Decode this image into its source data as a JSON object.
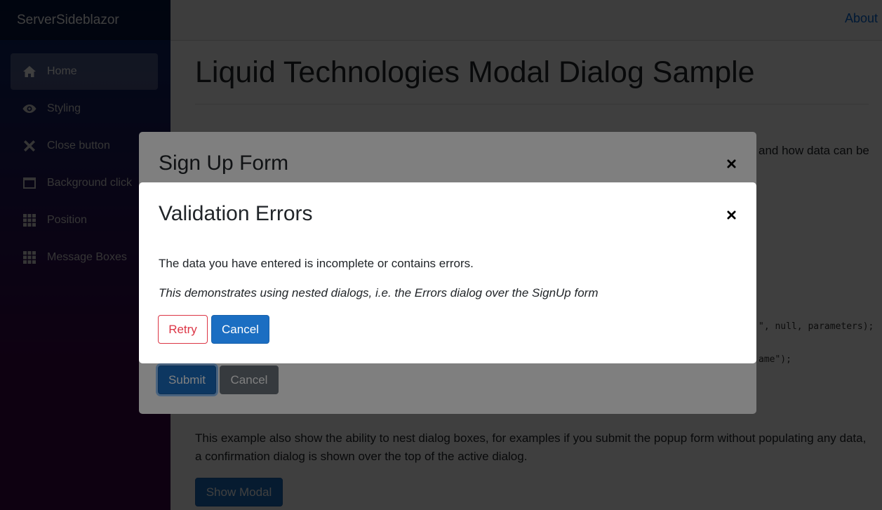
{
  "brand": "ServerSideblazor",
  "sidebar": {
    "items": [
      {
        "label": "Home",
        "icon": "home-icon"
      },
      {
        "label": "Styling",
        "icon": "eye-icon"
      },
      {
        "label": "Close button",
        "icon": "x-icon"
      },
      {
        "label": "Background click",
        "icon": "window-icon"
      },
      {
        "label": "Position",
        "icon": "grid-icon"
      },
      {
        "label": "Message Boxes",
        "icon": "grid-icon"
      }
    ]
  },
  "topbar": {
    "about": "About"
  },
  "page": {
    "title": "Liquid Technologies Modal Dialog Sample",
    "partial_text_right": "and how data can be",
    "code_line_1": "\", null, parameters);",
    "code_line_2": "ame\");",
    "paragraph": "This example also show the ability to nest dialog boxes, for examples if you submit the popup form without populating any data, a confirmation dialog is shown over the top of the active dialog.",
    "show_modal_label": "Show Modal"
  },
  "signup_dialog": {
    "title": "Sign Up Form",
    "submit_label": "Submit",
    "cancel_label": "Cancel"
  },
  "validation_dialog": {
    "title": "Validation Errors",
    "message": "The data you have entered is incomplete or contains errors.",
    "note": "This demonstrates using nested dialogs, i.e. the Errors dialog over the SignUp form",
    "retry_label": "Retry",
    "cancel_label": "Cancel"
  },
  "colors": {
    "primary": "#1b6ec2",
    "danger": "#dc3545",
    "secondary": "#6c757d",
    "link": "#0366d6"
  }
}
